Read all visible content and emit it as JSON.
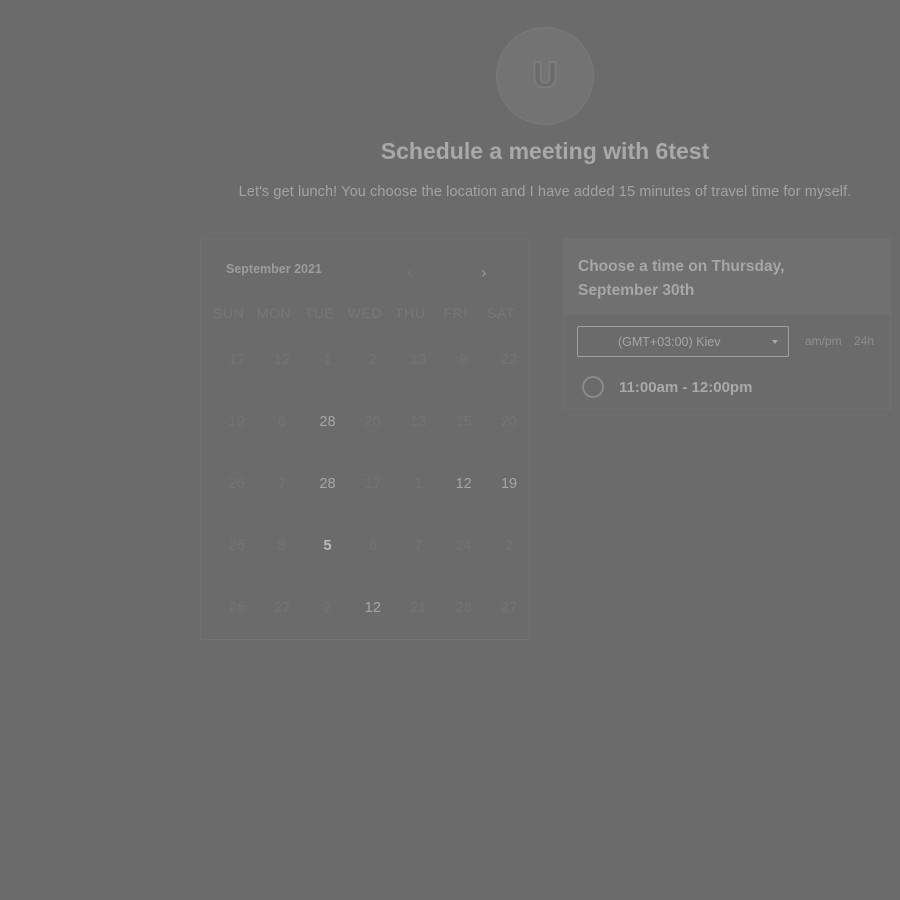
{
  "avatar": {
    "letter": "U",
    "icon": "user-initial-avatar"
  },
  "title": "Schedule a meeting with 6test",
  "description": "Let's get lunch! You choose the location and I have added 15 minutes of travel time for myself.",
  "calendar": {
    "month": "September 2021",
    "prev_icon": "chevron-left-icon",
    "next_icon": "chevron-right-icon",
    "weekdays": [
      "SUN",
      "MON",
      "TUE",
      "WED",
      "THU",
      "FRI",
      "SAT"
    ],
    "weeks": [
      [
        "17",
        "12",
        "1",
        "2",
        "13",
        "9",
        "22"
      ],
      [
        "19",
        "6",
        "28",
        "20",
        "13",
        "15",
        "20"
      ],
      [
        "26",
        "7",
        "28",
        "17",
        "1",
        "12",
        "19"
      ],
      [
        "26",
        "8",
        "5",
        "6",
        "7",
        "24",
        "2"
      ],
      [
        "26",
        "27",
        "2",
        "12",
        "21",
        "28",
        "27"
      ]
    ]
  },
  "time_picker": {
    "heading": "Choose a time on Thursday, September 30th",
    "timezone": "(GMT+03:00) Kiev",
    "format_ampm": "am/pm",
    "format_24h": "24h",
    "slots": [
      {
        "label": "11:00am - 12:00pm",
        "selected": false
      }
    ]
  },
  "colors": {
    "overlay": "#6b6b6b",
    "text_light": "#a9a9a9"
  }
}
